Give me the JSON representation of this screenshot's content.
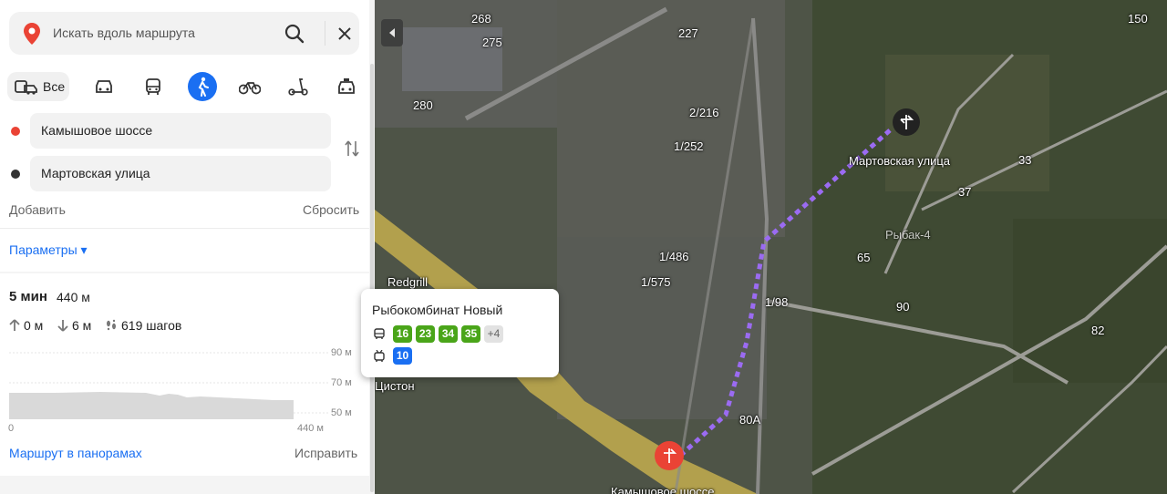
{
  "search": {
    "placeholder": "Искать вдоль маршрута"
  },
  "modes": {
    "all_label": "Все"
  },
  "route": {
    "from": "Камышовое шоссе",
    "to": "Мартовская улица",
    "add_label": "Добавить",
    "reset_label": "Сбросить",
    "params_label": "Параметры ▾"
  },
  "summary": {
    "time": "5 мин",
    "distance": "440 м",
    "ascent": "0 м",
    "descent": "6 м",
    "steps": "619 шагов",
    "elev_max": "90 м",
    "elev_mid": "70 м",
    "elev_min": "50 м",
    "axis_start": "0",
    "axis_end": "440 м",
    "panorama_label": "Маршрут в панорамах",
    "fix_label": "Исправить"
  },
  "map": {
    "end_label": "Мартовская улица",
    "start_label": "Камышовое шоссе",
    "poi_redgrill": "Redgrill",
    "poi_diston": "Цистон",
    "district_label": "Рыбак-4"
  },
  "stop_popup": {
    "title": "Рыбокомбинат Новый",
    "bus_routes": [
      "16",
      "23",
      "34",
      "35"
    ],
    "more": "+4",
    "trolley_routes": [
      "10"
    ]
  },
  "colors": {
    "accent": "#1a6ff2",
    "route": "#9b6bf2",
    "bus": "#4aa519",
    "start": "#ea4335"
  }
}
